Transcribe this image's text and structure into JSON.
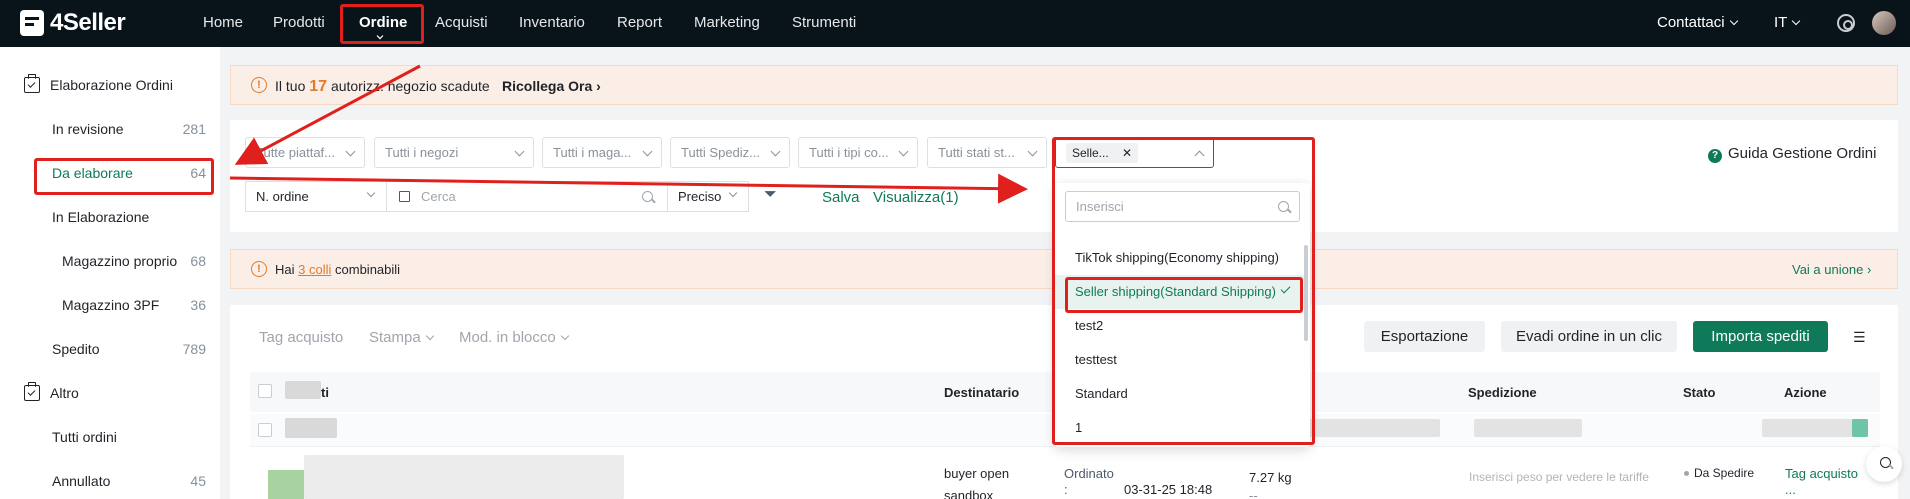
{
  "topbar": {
    "logo": "4Seller",
    "nav": [
      "Home",
      "Prodotti",
      "Ordine",
      "Acquisti",
      "Inventario",
      "Report",
      "Marketing",
      "Strumenti"
    ],
    "contact": "Contattaci",
    "lang": "IT"
  },
  "sidebar": {
    "group1": "Elaborazione Ordini",
    "items": [
      {
        "label": "In revisione",
        "count": "281"
      },
      {
        "label": "Da elaborare",
        "count": "64"
      },
      {
        "label": "In Elaborazione",
        "count": ""
      },
      {
        "label": "Magazzino proprio",
        "count": "68"
      },
      {
        "label": "Magazzino 3PF",
        "count": "36"
      },
      {
        "label": "Spedito",
        "count": "789"
      }
    ],
    "group2": "Altro",
    "items2": [
      {
        "label": "Tutti ordini",
        "count": ""
      },
      {
        "label": "Annullato",
        "count": "45"
      }
    ]
  },
  "alert1": {
    "prefix": "Il tuo",
    "count": "17",
    "suffix": "autorizz. negozio scadute",
    "link": "Ricollega Ora"
  },
  "filters": {
    "platform": "Tutte piattaf...",
    "shops": "Tutti i negozi",
    "warehouses": "Tutti i maga...",
    "shipping": "Tutti Spediz...",
    "types": "Tutti i tipi co...",
    "states": "Tutti stati st...",
    "tag": "Selle...",
    "guide": "Guida Gestione Ordini",
    "order_field": "N. ordine",
    "search_placeholder": "Cerca",
    "match": "Preciso",
    "save": "Salva",
    "view": "Visualizza(1)"
  },
  "dropdown": {
    "placeholder": "Inserisci",
    "options": [
      "TikTok shipping(Economy shipping)",
      "Seller shipping(Standard Shipping)",
      "test2",
      "testtest",
      "Standard",
      "1"
    ]
  },
  "alert2": {
    "prefix": "Hai",
    "link": "3 colli",
    "suffix": "combinabili",
    "action": "Vai a unione"
  },
  "toolbar": {
    "tag": "Tag acquisto",
    "print": "Stampa",
    "bulk": "Mod. in blocco",
    "export": "Esportazione",
    "one_click": "Evadi ordine in un clic",
    "import": "Importa spediti"
  },
  "table": {
    "headers": {
      "products": "ti",
      "recipient": "Destinatario",
      "shipping": "Spedizione",
      "status": "Stato",
      "action": "Azione"
    },
    "row": {
      "recipient_line1": "buyer open",
      "recipient_line2": "sandbox",
      "ordered_label": "Ordinato",
      "ordered_colon": ":",
      "date": "03-31-25 18:48",
      "weight": "7.27 kg",
      "weight_sub": "--",
      "ship_hint": "Inserisci peso per vedere le tariffe",
      "status": "Da Spedire",
      "action": "Tag acquisto",
      "action_more": "..."
    }
  },
  "colors": {
    "accent": "#0f7a5a",
    "warning": "#e07b2b",
    "annotation": "#e0201c"
  }
}
